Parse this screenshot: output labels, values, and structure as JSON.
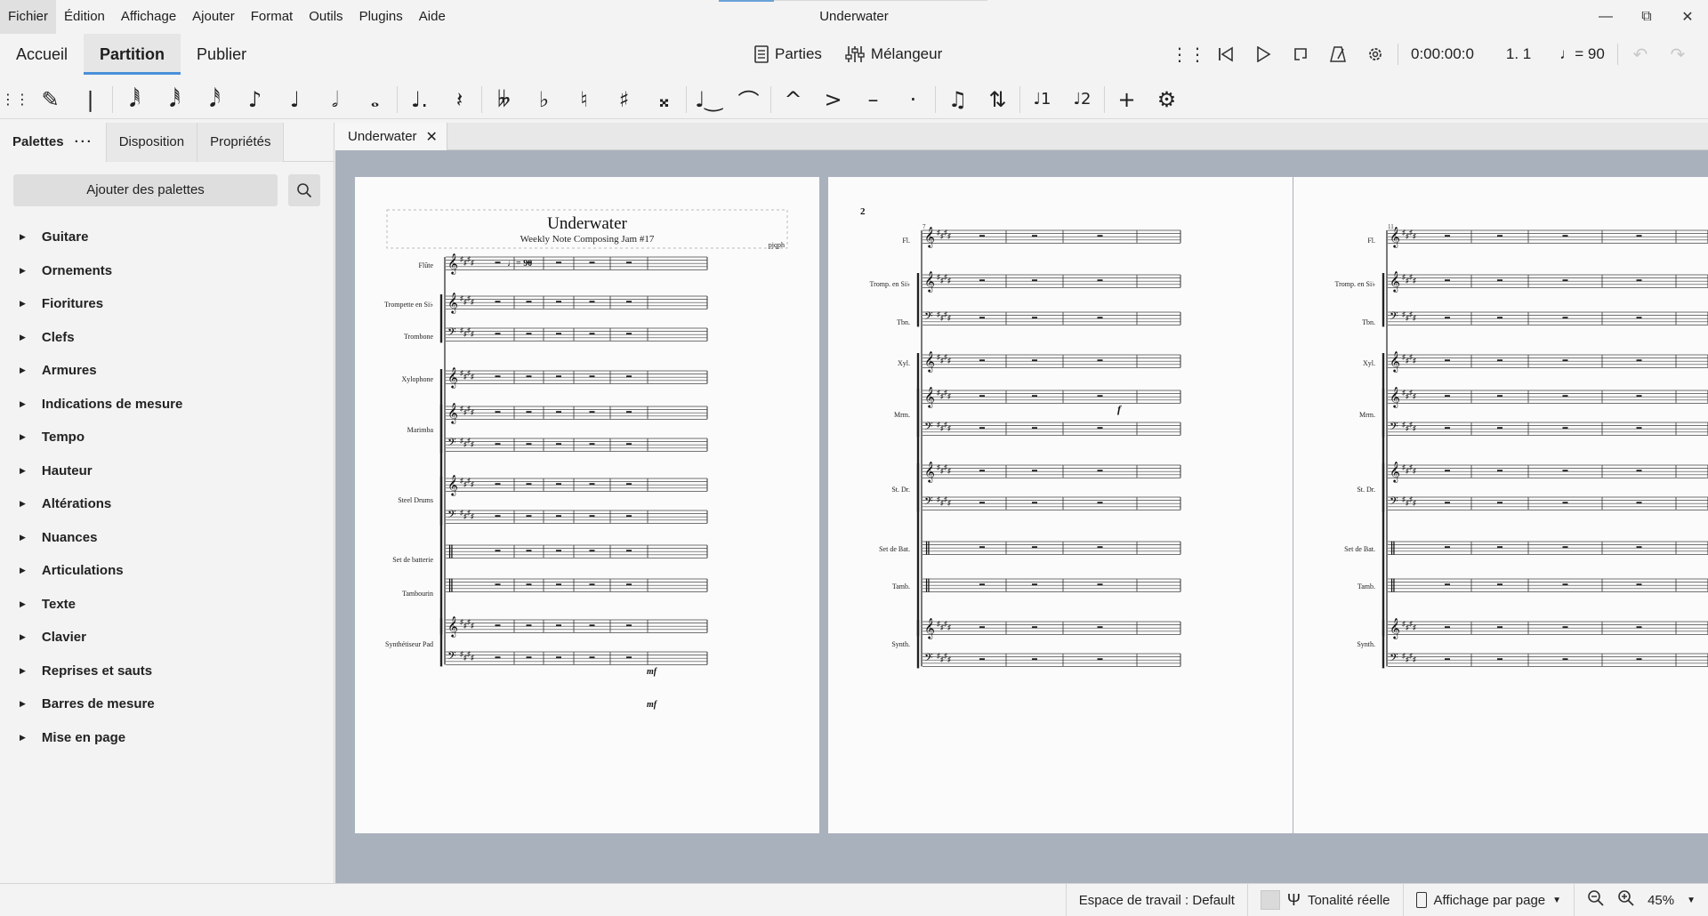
{
  "menu": [
    "Fichier",
    "Édition",
    "Affichage",
    "Ajouter",
    "Format",
    "Outils",
    "Plugins",
    "Aide"
  ],
  "window": {
    "title": "Underwater"
  },
  "top_tabs": [
    "Accueil",
    "Partition",
    "Publier"
  ],
  "center_tools": {
    "parts": "Parties",
    "mixer": "Mélangeur"
  },
  "playback": {
    "time": "0:00:00:0",
    "position": "1. 1",
    "tempo": "= 90"
  },
  "left_panel": {
    "tabs": [
      "Palettes",
      "Disposition",
      "Propriétés"
    ],
    "add_palettes": "Ajouter des palettes",
    "palettes": [
      "Guitare",
      "Ornements",
      "Fioritures",
      "Clefs",
      "Armures",
      "Indications de mesure",
      "Tempo",
      "Hauteur",
      "Altérations",
      "Nuances",
      "Articulations",
      "Texte",
      "Clavier",
      "Reprises et sauts",
      "Barres de mesure",
      "Mise en page"
    ]
  },
  "document_tab": "Underwater",
  "score": {
    "title": "Underwater",
    "subtitle": "Weekly Note Composing Jam #17",
    "composer": "pjqph",
    "tempo_mark": "♩= 90",
    "page2_number": "2",
    "page1_instruments": [
      "Flûte",
      "Trompette en Si♭",
      "Trombone",
      "Xylophone",
      "Marimba",
      "Steel Drums",
      "Set de batterie",
      "Tambourin",
      "Synthétiseur Pad"
    ],
    "page2_instruments": [
      "Fl.",
      "Tromp. en Si♭",
      "Tbn.",
      "Xyl.",
      "Mrm.",
      "St. Dr.",
      "Set de Bat.",
      "Tamb.",
      "Synth."
    ],
    "page2_measure": "7",
    "page3_measure": "11",
    "dynamics": {
      "f": "f",
      "mf": "mf"
    }
  },
  "status": {
    "workspace": "Espace de travail : Default",
    "concert_pitch": "Tonalité réelle",
    "view_mode": "Affichage par page",
    "zoom": "45%"
  }
}
